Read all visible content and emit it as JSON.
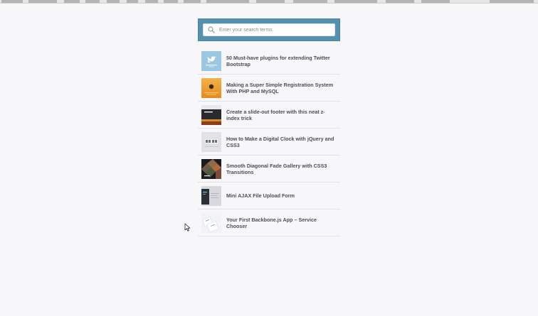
{
  "search": {
    "placeholder": "Enter your search terms"
  },
  "results": [
    {
      "title": "50 Must-have plugins for extending Twitter Bootstrap",
      "thumb_icon": "twitter-bird-icon"
    },
    {
      "title": "Making a Super Simple Registration System With PHP and MySQL",
      "thumb_icon": "registration-thumb"
    },
    {
      "title": "Create a slide-out footer with this neat z-index trick",
      "thumb_icon": "footer-thumb"
    },
    {
      "title": "How to Make a Digital Clock with jQuery and CSS3",
      "thumb_icon": "clock-thumb"
    },
    {
      "title": "Smooth Diagonal Fade Gallery with CSS3 Transitions",
      "thumb_icon": "gallery-thumb"
    },
    {
      "title": "Mini AJAX File Upload Form",
      "thumb_icon": "upload-thumb"
    },
    {
      "title": "Your First Backbone.js App – Service Chooser",
      "thumb_icon": "backbone-thumb"
    }
  ],
  "colors": {
    "search_frame": "#5590ad",
    "title_text": "#4a4f57",
    "page_bg": "#f7f7fa"
  }
}
